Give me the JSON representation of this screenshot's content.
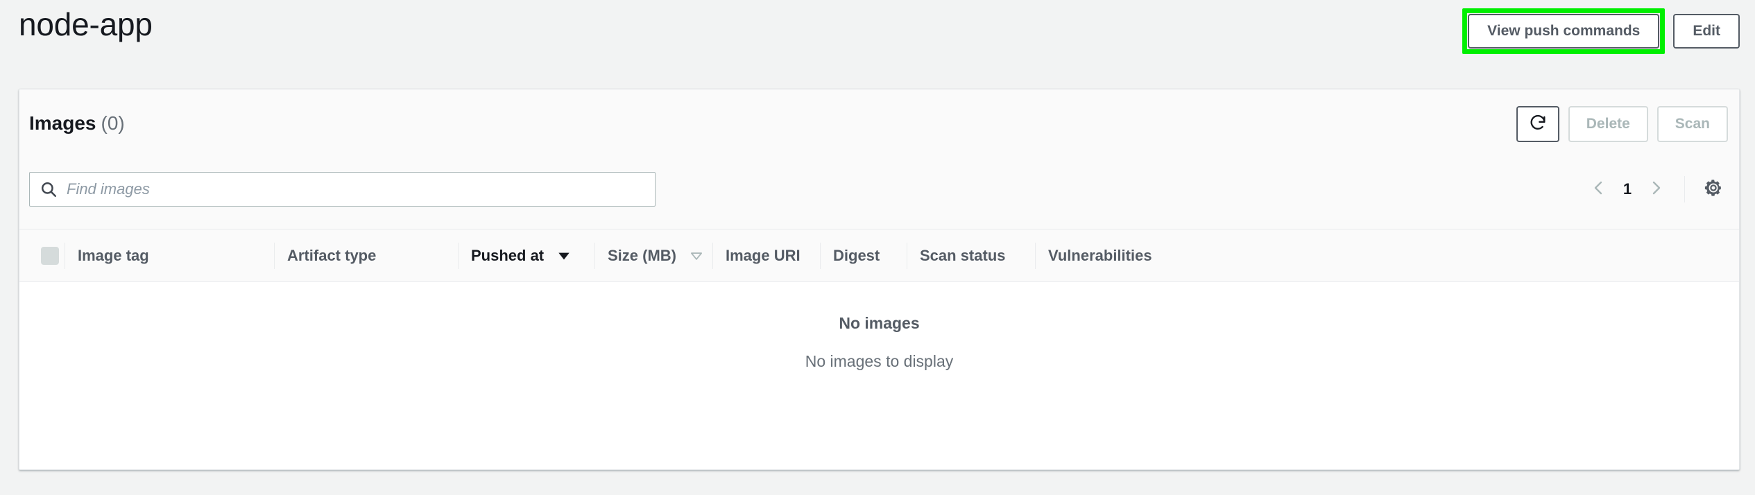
{
  "header": {
    "title": "node-app",
    "view_push_commands_label": "View push commands",
    "edit_label": "Edit",
    "highlight_color": "#00ef00"
  },
  "card": {
    "title": "Images",
    "count": "(0)",
    "actions": {
      "refresh_icon": "refresh-icon",
      "delete_label": "Delete",
      "delete_disabled": true,
      "scan_label": "Scan",
      "scan_disabled": true
    }
  },
  "toolbar": {
    "search_icon": "search-icon",
    "search_value": "",
    "search_placeholder": "Find images",
    "pagination": {
      "prev_icon": "chevron-left-icon",
      "page": "1",
      "next_icon": "chevron-right-icon",
      "prev_disabled": true,
      "next_disabled": true
    },
    "settings_icon": "gear-icon"
  },
  "table": {
    "select_all_checkbox": "select-all-checkbox",
    "columns": [
      {
        "label": "Image tag",
        "sort": "none",
        "divider": true
      },
      {
        "label": "Artifact type",
        "sort": "none",
        "divider": true
      },
      {
        "label": "Pushed at",
        "sort": "descending",
        "divider": true
      },
      {
        "label": "Size (MB)",
        "sort": "sortable",
        "divider": true
      },
      {
        "label": "Image URI",
        "sort": "none",
        "divider": true
      },
      {
        "label": "Digest",
        "sort": "none",
        "divider": true
      },
      {
        "label": "Scan status",
        "sort": "none",
        "divider": true
      },
      {
        "label": "Vulnerabilities",
        "sort": "none",
        "divider": false
      }
    ],
    "rows": [],
    "empty_title": "No images",
    "empty_subtitle": "No images to display"
  }
}
